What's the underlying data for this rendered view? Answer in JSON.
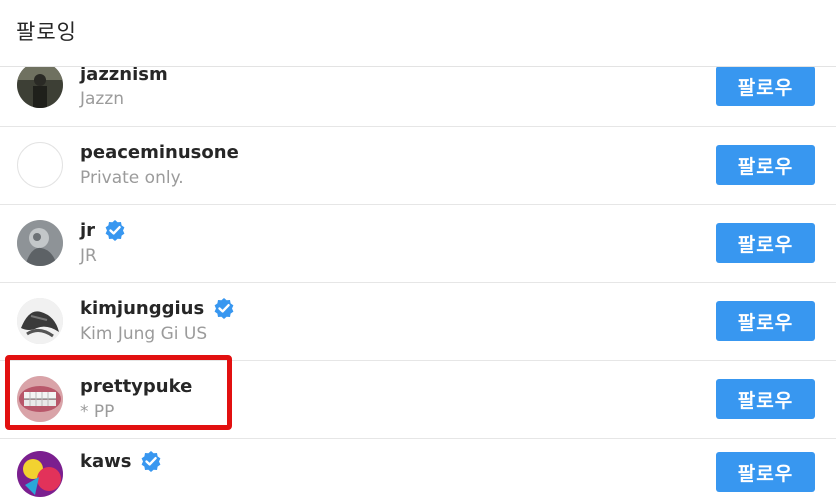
{
  "header": {
    "title": "팔로잉"
  },
  "accounts": [
    {
      "username": "jazznism",
      "fullname": "Jazzn",
      "verified": false,
      "follow_label": "팔로우"
    },
    {
      "username": "peaceminusone",
      "fullname": "Private only.",
      "verified": false,
      "follow_label": "팔로우"
    },
    {
      "username": "jr",
      "fullname": "JR",
      "verified": true,
      "follow_label": "팔로우"
    },
    {
      "username": "kimjunggius",
      "fullname": "Kim Jung Gi US",
      "verified": true,
      "follow_label": "팔로우"
    },
    {
      "username": "prettypuke",
      "fullname": "* PP",
      "verified": false,
      "follow_label": "팔로우"
    },
    {
      "username": "kaws",
      "fullname": "",
      "verified": true,
      "follow_label": "팔로우"
    }
  ],
  "colors": {
    "follow_button": "#3897f0",
    "verified_badge": "#3897f0",
    "highlight": "#e21010"
  },
  "icons": {
    "verified": "verified-badge-icon"
  }
}
